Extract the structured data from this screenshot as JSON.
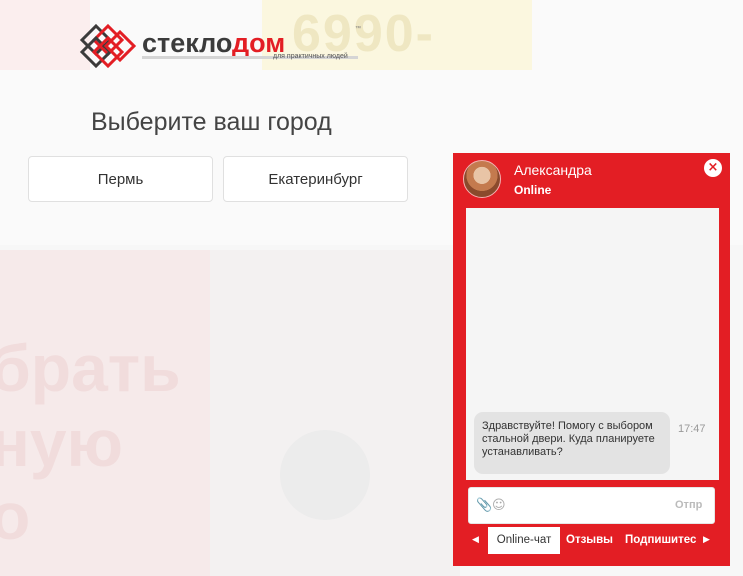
{
  "background": {
    "promo_price": "6990-",
    "promo_words": [
      "брать",
      "ную",
      "о"
    ]
  },
  "logo": {
    "text_part1": "стекло",
    "text_part2": "дом",
    "tagline": "для практичных людей",
    "trademark": "™"
  },
  "city_select": {
    "title": "Выберите ваш город",
    "cities": [
      "Пермь",
      "Екатеринбург"
    ]
  },
  "chat": {
    "operator_name": "Александра",
    "status": "Online",
    "close_icon": "×",
    "message": {
      "text": "Здравствуйте! Помогу с выбором стальной двери. Куда планируете устанавливать?",
      "time": "17:47"
    },
    "input": {
      "attach_icon": "📎",
      "emoji_icon": "☺",
      "send_label": "Отпр"
    },
    "tabs": {
      "prev_icon": "◀",
      "next_icon": "▶",
      "items": [
        "Online-чат",
        "Отзывы",
        "Подпишитес"
      ]
    }
  },
  "colors": {
    "brand_red": "#e31e24",
    "logo_dark": "#3b3b3b"
  }
}
